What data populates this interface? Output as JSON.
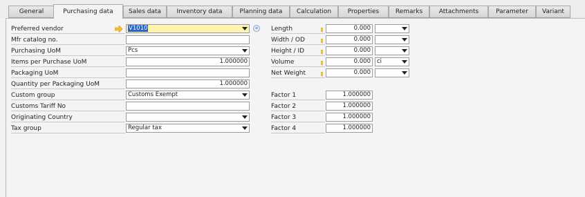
{
  "tabs": [
    {
      "label": "General"
    },
    {
      "label": "Purchasing data"
    },
    {
      "label": "Sales data"
    },
    {
      "label": "Inventory data"
    },
    {
      "label": "Planning data"
    },
    {
      "label": "Calculation"
    },
    {
      "label": "Properties"
    },
    {
      "label": "Remarks"
    },
    {
      "label": "Attachments"
    },
    {
      "label": "Parameter"
    },
    {
      "label": "Variant"
    }
  ],
  "active_tab": "Purchasing data",
  "left": {
    "preferred_vendor": {
      "label": "Preferred vendor",
      "value": "V1010"
    },
    "mfr_catalog": {
      "label": "Mfr catalog no.",
      "value": ""
    },
    "purchasing_uom": {
      "label": "Purchasing UoM",
      "value": "Pcs"
    },
    "items_per_uom": {
      "label": "Items per Purchase UoM",
      "value": "1.000000"
    },
    "packaging_uom": {
      "label": "Packaging UoM",
      "value": ""
    },
    "qty_per_packaging": {
      "label": "Quantity per Packaging UoM",
      "value": "1.000000"
    },
    "custom_group": {
      "label": "Custom group",
      "value": "Customs Exempt"
    },
    "customs_tariff": {
      "label": "Customs Tariff No",
      "value": ""
    },
    "orig_country": {
      "label": "Originating Country",
      "value": ""
    },
    "tax_group": {
      "label": "Tax group",
      "value": "Regular tax"
    }
  },
  "right": {
    "length": {
      "label": "Length",
      "value": "0.000",
      "unit": ""
    },
    "width": {
      "label": "Width / OD",
      "value": "0.000",
      "unit": ""
    },
    "height": {
      "label": "Height / ID",
      "value": "0.000",
      "unit": ""
    },
    "volume": {
      "label": "Volume",
      "value": "0.000",
      "unit": "ci"
    },
    "net_weight": {
      "label": "Net Weight",
      "value": "0.000",
      "unit": ""
    },
    "factor1": {
      "label": "Factor 1",
      "value": "1.000000"
    },
    "factor2": {
      "label": "Factor 2",
      "value": "1.000000"
    },
    "factor3": {
      "label": "Factor 3",
      "value": "1.000000"
    },
    "factor4": {
      "label": "Factor 4",
      "value": "1.000000"
    }
  },
  "colors": {
    "selection": "#2a64c5",
    "highlight": "#fff3b0",
    "marker": "#f5d878"
  }
}
